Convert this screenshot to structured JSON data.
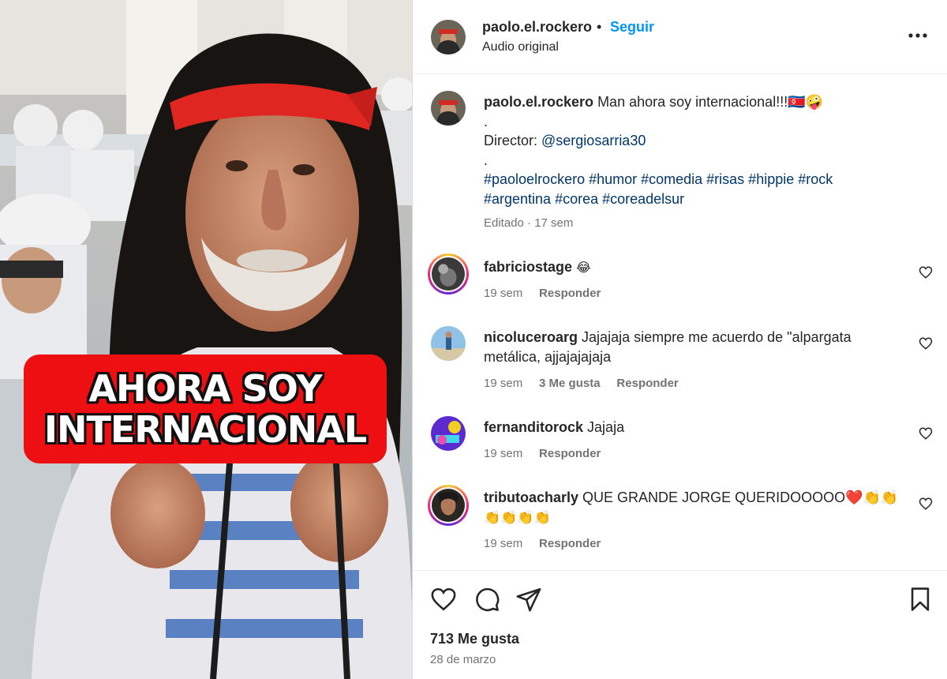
{
  "media": {
    "overlay_line1": "AHORA SOY",
    "overlay_line2": "INTERNACIONAL"
  },
  "header": {
    "username": "paolo.el.rockero",
    "separator": "•",
    "follow_label": "Seguir",
    "audio_label": "Audio original",
    "more_icon": "more-horizontal-icon"
  },
  "caption": {
    "username": "paolo.el.rockero",
    "text": "Man ahora soy internacional!!!🇰🇵🤪",
    "dot1": ".",
    "director_label": "Director: ",
    "director_mention": "@sergiosarria30",
    "dot2": ".",
    "hashtags_line1": "#paoloelrockero #humor #comedia #risas #hippie #rock",
    "hashtags_line2": "#argentina #corea #coreadelsur",
    "edited": "Editado · 17 sem"
  },
  "comments": [
    {
      "username": "fabriciostage",
      "text": "😂",
      "time": "19 sem",
      "likes": "",
      "reply": "Responder"
    },
    {
      "username": "nicoluceroarg",
      "text_line1": "Jajajaja siempre me acuerdo de \"alpargata",
      "text_line2": "metálica, ajjajajajaja",
      "time": "19 sem",
      "likes": "3 Me gusta",
      "reply": "Responder"
    },
    {
      "username": "fernanditorock",
      "text": "Jajaja",
      "time": "19 sem",
      "likes": "",
      "reply": "Responder"
    },
    {
      "username": "tributoacharly",
      "text_line1": "QUE GRANDE JORGE QUERIDOOOOO❤️👏👏",
      "text_line2": "👏👏👏👏",
      "time": "19 sem",
      "likes": "",
      "reply": "Responder"
    }
  ],
  "actions": {
    "like_icon": "heart-icon",
    "comment_icon": "comment-icon",
    "share_icon": "send-icon",
    "save_icon": "bookmark-icon",
    "likes_count": "713 Me gusta",
    "date": "28 de marzo"
  },
  "colors": {
    "follow_blue": "#0095f6",
    "link_blue": "#00376b",
    "banner_red": "#ee0f12",
    "muted_gray": "#737373"
  }
}
